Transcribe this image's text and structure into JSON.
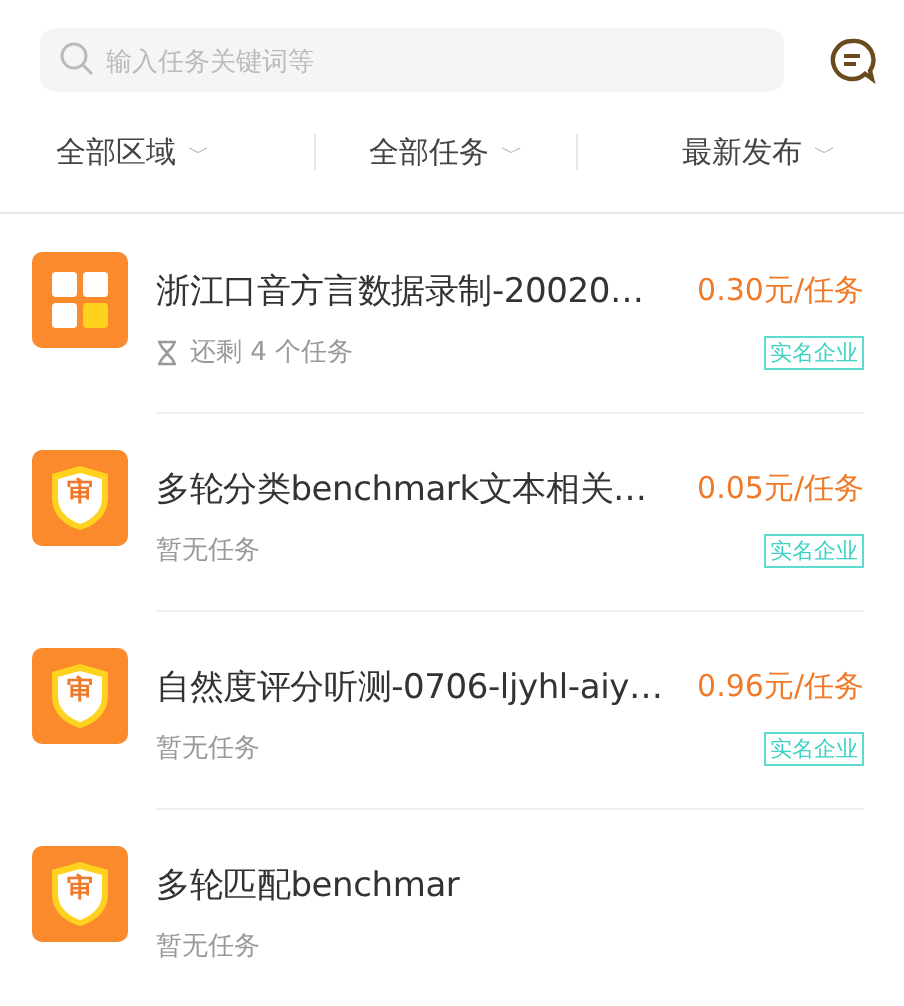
{
  "search": {
    "placeholder": "输入任务关键词等"
  },
  "filters": [
    {
      "label": "全部区域",
      "caret": "﹀"
    },
    {
      "label": "全部任务",
      "caret": "﹀"
    },
    {
      "label": "最新发布",
      "caret": "﹀"
    }
  ],
  "tasks": [
    {
      "kind": "grid",
      "title": "浙江口音方言数据录制-20020…",
      "price": "0.30元/任务",
      "status": "还剩 4 个任务",
      "status_icon": true,
      "badge": "实名企业"
    },
    {
      "kind": "shield",
      "icon_text": "审",
      "title": "多轮分类benchmark文本相关…",
      "price": "0.05元/任务",
      "status": "暂无任务",
      "status_icon": false,
      "badge": "实名企业"
    },
    {
      "kind": "shield",
      "icon_text": "审",
      "title": "自然度评分听测-0706-ljyhl-aiy…",
      "price": "0.96元/任务",
      "status": "暂无任务",
      "status_icon": false,
      "badge": "实名企业"
    },
    {
      "kind": "shield",
      "icon_text": "审",
      "title": "多轮匹配benchmar",
      "status": "暂无任务",
      "status_icon": false
    }
  ]
}
